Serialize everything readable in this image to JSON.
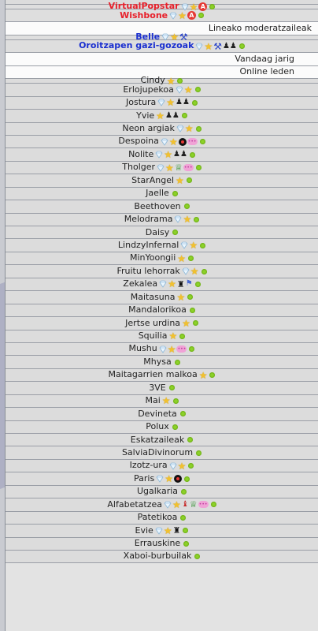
{
  "staff": [
    {
      "name": "VirtualPopstar",
      "color": "#e8202a",
      "icons": [
        "diamond-icon",
        "star-icon",
        "admin-icon",
        "online-dot-icon"
      ]
    },
    {
      "name": "Wishbone",
      "color": "#e8202a",
      "icons": [
        "diamond-icon",
        "star-icon",
        "admin-icon",
        "online-dot-icon"
      ]
    }
  ],
  "headers": {
    "moderators": "Lineako moderatzaileak",
    "birthday": "Vandaag jarig",
    "online": "Online leden"
  },
  "moderators": [
    {
      "name": "Belle",
      "color": "#1a2fd0",
      "icons": [
        "diamond-icon",
        "star-icon",
        "gavel-icon"
      ]
    },
    {
      "name": "Oroitzapen gazi-gozoak",
      "color": "#1a2fd0",
      "icons": [
        "diamond-icon",
        "star-icon",
        "gavel-icon",
        "people-icon",
        "online-dot-icon"
      ]
    }
  ],
  "online_members": [
    {
      "name": "Cindy",
      "icons": [
        "star-icon",
        "online-dot-icon"
      ]
    },
    {
      "name": "Erlojupekoa",
      "icons": [
        "diamond-icon",
        "star-icon",
        "online-dot-icon"
      ]
    },
    {
      "name": "Jostura",
      "icons": [
        "diamond-icon",
        "star-icon",
        "people-icon",
        "online-dot-icon"
      ]
    },
    {
      "name": "Yvie",
      "icons": [
        "star-icon",
        "people-icon",
        "online-dot-icon"
      ]
    },
    {
      "name": "Neon argiak",
      "icons": [
        "diamond-icon",
        "star-icon",
        "online-dot-icon"
      ]
    },
    {
      "name": "Despoina",
      "icons": [
        "diamond-icon",
        "star-icon",
        "record-icon",
        "chat-bubble-icon",
        "online-dot-icon"
      ]
    },
    {
      "name": "Nolite",
      "icons": [
        "diamond-icon",
        "star-icon",
        "people-icon",
        "online-dot-icon"
      ]
    },
    {
      "name": "Tholger",
      "icons": [
        "diamond-icon",
        "star-icon",
        "trophy-icon",
        "chat-bubble-icon",
        "online-dot-icon"
      ]
    },
    {
      "name": "StarAngel",
      "icons": [
        "star-icon",
        "online-dot-icon"
      ]
    },
    {
      "name": "Jaelle",
      "icons": [
        "online-dot-icon"
      ]
    },
    {
      "name": "Beethoven",
      "icons": [
        "online-dot-icon"
      ]
    },
    {
      "name": "Melodrama",
      "icons": [
        "diamond-icon",
        "star-icon",
        "online-dot-icon"
      ]
    },
    {
      "name": "Daisy",
      "icons": [
        "online-dot-icon"
      ]
    },
    {
      "name": "LindzyInfernal",
      "icons": [
        "diamond-icon",
        "star-icon",
        "online-dot-icon"
      ]
    },
    {
      "name": "MinYoongii",
      "icons": [
        "star-icon",
        "online-dot-icon"
      ]
    },
    {
      "name": "Fruitu lehorrak",
      "icons": [
        "diamond-icon",
        "star-icon",
        "online-dot-icon"
      ]
    },
    {
      "name": "Zekalea",
      "icons": [
        "diamond-icon",
        "star-icon",
        "chess-icon",
        "flag-icon",
        "online-dot-icon"
      ]
    },
    {
      "name": "Maitasuna",
      "icons": [
        "star-icon",
        "online-dot-icon"
      ]
    },
    {
      "name": "Mandalorikoa",
      "icons": [
        "online-dot-icon"
      ]
    },
    {
      "name": "Jertse urdina",
      "icons": [
        "star-icon",
        "online-dot-icon"
      ]
    },
    {
      "name": "Squilia",
      "icons": [
        "star-icon",
        "online-dot-icon"
      ]
    },
    {
      "name": "Mushu",
      "icons": [
        "diamond-icon",
        "star-icon",
        "chat-bubble-icon",
        "online-dot-icon"
      ]
    },
    {
      "name": "Mhysa",
      "icons": [
        "online-dot-icon"
      ]
    },
    {
      "name": "Maitagarrien malkoa",
      "icons": [
        "star-icon",
        "online-dot-icon"
      ]
    },
    {
      "name": "3VE",
      "icons": [
        "online-dot-icon"
      ]
    },
    {
      "name": "Mai",
      "icons": [
        "star-icon",
        "online-dot-icon"
      ]
    },
    {
      "name": "Devineta",
      "icons": [
        "online-dot-icon"
      ]
    },
    {
      "name": "Polux",
      "icons": [
        "online-dot-icon"
      ]
    },
    {
      "name": "Eskatzaileak",
      "icons": [
        "online-dot-icon"
      ]
    },
    {
      "name": "SalviaDivinorum",
      "icons": [
        "online-dot-icon"
      ]
    },
    {
      "name": "Izotz-ura",
      "icons": [
        "diamond-icon",
        "star-icon",
        "online-dot-icon"
      ]
    },
    {
      "name": "Paris",
      "icons": [
        "diamond-icon",
        "star-icon",
        "record-icon",
        "online-dot-icon"
      ]
    },
    {
      "name": "Ugalkaria",
      "icons": [
        "online-dot-icon"
      ]
    },
    {
      "name": "Alfabetatzea",
      "icons": [
        "diamond-icon",
        "star-icon",
        "guard-icon",
        "trophy-icon",
        "chat-bubble-icon",
        "online-dot-icon"
      ]
    },
    {
      "name": "Patetikoa",
      "icons": [
        "online-dot-icon"
      ]
    },
    {
      "name": "Evie",
      "icons": [
        "diamond-icon",
        "star-icon",
        "chess-icon",
        "online-dot-icon"
      ]
    },
    {
      "name": "Errauskine",
      "icons": [
        "online-dot-icon"
      ]
    },
    {
      "name": "Xaboi-burbuilak",
      "icons": [
        "online-dot-icon"
      ]
    }
  ]
}
